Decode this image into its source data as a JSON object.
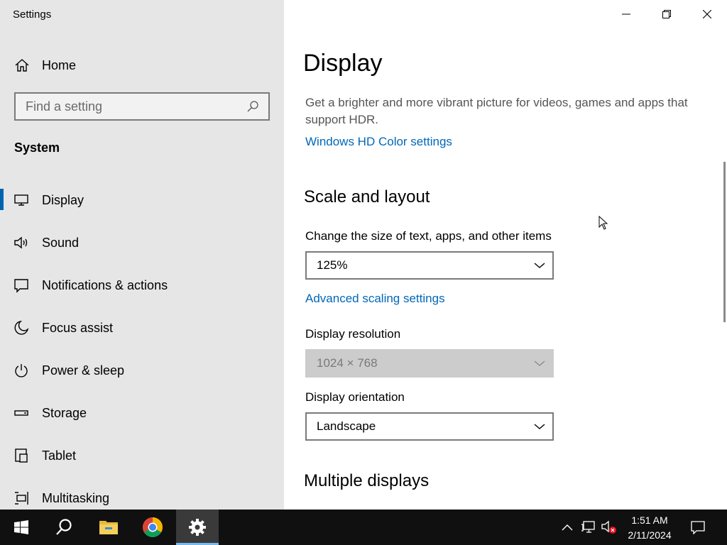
{
  "window": {
    "title": "Settings"
  },
  "sidebar": {
    "home_label": "Home",
    "search_placeholder": "Find a setting",
    "section_title": "System",
    "items": [
      {
        "label": "Display",
        "icon": "monitor-icon",
        "active": true
      },
      {
        "label": "Sound",
        "icon": "speaker-icon"
      },
      {
        "label": "Notifications & actions",
        "icon": "notification-icon"
      },
      {
        "label": "Focus assist",
        "icon": "moon-icon"
      },
      {
        "label": "Power & sleep",
        "icon": "power-icon"
      },
      {
        "label": "Storage",
        "icon": "storage-icon"
      },
      {
        "label": "Tablet",
        "icon": "tablet-icon"
      },
      {
        "label": "Multitasking",
        "icon": "multitasking-icon"
      }
    ]
  },
  "main": {
    "title": "Display",
    "hdr_description": "Get a brighter and more vibrant picture for videos, games and apps that support HDR.",
    "hdr_link": "Windows HD Color settings",
    "scale_heading": "Scale and layout",
    "scale_label": "Change the size of text, apps, and other items",
    "scale_value": "125%",
    "advanced_scaling_link": "Advanced scaling settings",
    "resolution_label": "Display resolution",
    "resolution_value": "1024 × 768",
    "orientation_label": "Display orientation",
    "orientation_value": "Landscape",
    "multiple_heading": "Multiple displays"
  },
  "taskbar": {
    "time": "1:51 AM",
    "date": "2/11/2024"
  },
  "colors": {
    "accent": "#0063b1",
    "link": "#0067b8",
    "sidebar_bg": "#e6e6e6",
    "taskbar_bg": "#101010"
  }
}
